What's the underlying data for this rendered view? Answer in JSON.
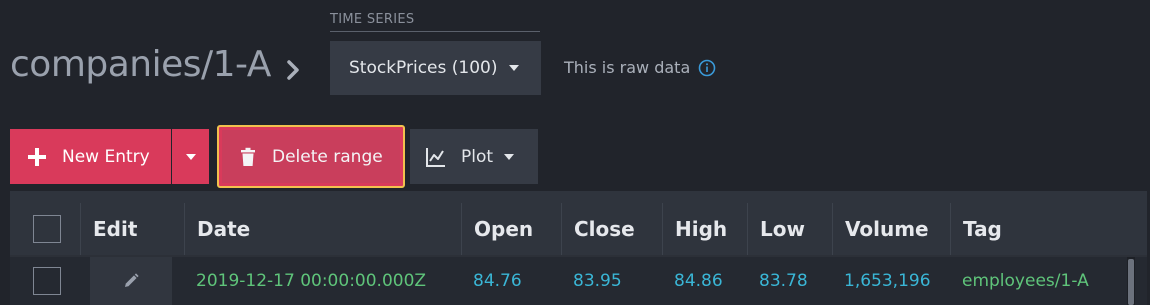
{
  "header": {
    "document_title": "companies/1-A",
    "time_series_label": "TIME SERIES",
    "time_series_selected": "StockPrices (100)",
    "raw_note": "This is raw data"
  },
  "toolbar": {
    "new_entry_label": "New Entry",
    "delete_range_label": "Delete range",
    "plot_label": "Plot"
  },
  "table": {
    "columns": [
      "Edit",
      "Date",
      "Open",
      "Close",
      "High",
      "Low",
      "Volume",
      "Tag"
    ],
    "rows": [
      {
        "date": "2019-12-17 00:00:00.000Z",
        "open": "84.76",
        "close": "83.95",
        "high": "84.86",
        "low": "83.78",
        "volume": "1,653,196",
        "tag": "employees/1-A"
      }
    ]
  },
  "icons": {
    "chevron": "chevron-right-icon",
    "info": "info-icon",
    "plus": "plus-icon",
    "trash": "trash-icon",
    "plot": "line-chart-icon",
    "edit": "pencil-icon"
  },
  "colors": {
    "accent": "#d93a5b",
    "focus_outline": "#f2c14e",
    "date_text": "#5fc47a",
    "number_text": "#3ab6d6",
    "info_icon": "#3a9ad9"
  }
}
